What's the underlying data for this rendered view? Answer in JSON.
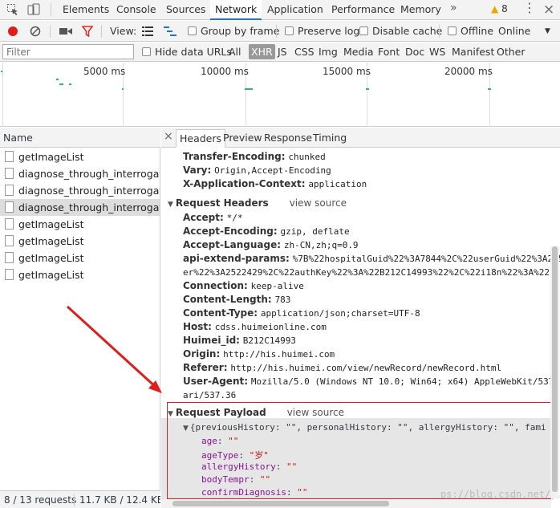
{
  "main_tabs": [
    "Elements",
    "Console",
    "Sources",
    "Network",
    "Application",
    "Performance",
    "Memory"
  ],
  "more": "»",
  "warning_count": "8",
  "toolbar": {
    "view_label": "View:",
    "group_by_frame": "Group by frame",
    "preserve_log": "Preserve log",
    "disable_cache": "Disable cache",
    "offline": "Offline",
    "throttle": "Online"
  },
  "filter": {
    "placeholder": "Filter",
    "hide_data_urls": "Hide data URLs",
    "types": [
      "All",
      "XHR",
      "JS",
      "CSS",
      "Img",
      "Media",
      "Font",
      "Doc",
      "WS",
      "Manifest",
      "Other"
    ]
  },
  "overview": {
    "ticks": [
      "5000 ms",
      "10000 ms",
      "15000 ms",
      "20000 ms"
    ]
  },
  "requests": {
    "header": "Name",
    "items": [
      "getImageList",
      "diagnose_through_interrogation",
      "diagnose_through_interrogation",
      "diagnose_through_interrogation",
      "getImageList",
      "getImageList",
      "getImageList",
      "getImageList"
    ],
    "selected_index": 3,
    "footer_count": "8 / 13 requests",
    "footer_size": "11.7 KB / 12.4 KB..."
  },
  "detail": {
    "tabs": [
      "Headers",
      "Preview",
      "Response",
      "Timing"
    ],
    "response_headers": [
      {
        "k": "Transfer-Encoding:",
        "v": "chunked"
      },
      {
        "k": "Vary:",
        "v": "Origin,Accept-Encoding"
      },
      {
        "k": "X-Application-Context:",
        "v": "application"
      }
    ],
    "request_headers_title": "Request Headers",
    "view_source": "view source",
    "request_headers": [
      {
        "k": "Accept:",
        "v": "*/*"
      },
      {
        "k": "Accept-Encoding:",
        "v": "gzip, deflate"
      },
      {
        "k": "Accept-Language:",
        "v": "zh-CN,zh;q=0.9"
      },
      {
        "k": "api-extend-params:",
        "v": "%7B%22hospitalGuid%22%3A7844%2C%22userGuid%22%3A215"
      },
      {
        "k": "",
        "v": "er%22%3A2522429%2C%22authKey%22%3A%22B212C14993%22%2C%22i18n%22%3A%22"
      },
      {
        "k": "Connection:",
        "v": "keep-alive"
      },
      {
        "k": "Content-Length:",
        "v": "783"
      },
      {
        "k": "Content-Type:",
        "v": "application/json;charset=UTF-8"
      },
      {
        "k": "Host:",
        "v": "cdss.huimeionline.com"
      },
      {
        "k": "Huimei_id:",
        "v": "B212C14993"
      },
      {
        "k": "Origin:",
        "v": "http://his.huimei.com"
      },
      {
        "k": "Referer:",
        "v": "http://his.huimei.com/view/newRecord/newRecord.html"
      },
      {
        "k": "User-Agent:",
        "v": "Mozilla/5.0 (Windows NT 10.0; Win64; x64) AppleWebKit/537."
      },
      {
        "k": "",
        "v": "ari/537.36"
      }
    ],
    "payload_title": "Request Payload",
    "payload_summary": "{previousHistory: \"\", personalHistory: \"\", allergyHistory: \"\", fami",
    "payload_fields": [
      {
        "k": "age",
        "v": "\"\""
      },
      {
        "k": "ageType",
        "v": "\"岁\""
      },
      {
        "k": "allergyHistory",
        "v": "\"\""
      },
      {
        "k": "bodyTempr",
        "v": "\"\""
      },
      {
        "k": "confirmDiagnosis",
        "v": "\"\""
      }
    ],
    "watermark": "ps://blog.csdn.net/yueshutong123"
  },
  "colors": {
    "accent": "#1a73e8",
    "record": "#e21b1b",
    "annotation": "#e01e1e"
  }
}
